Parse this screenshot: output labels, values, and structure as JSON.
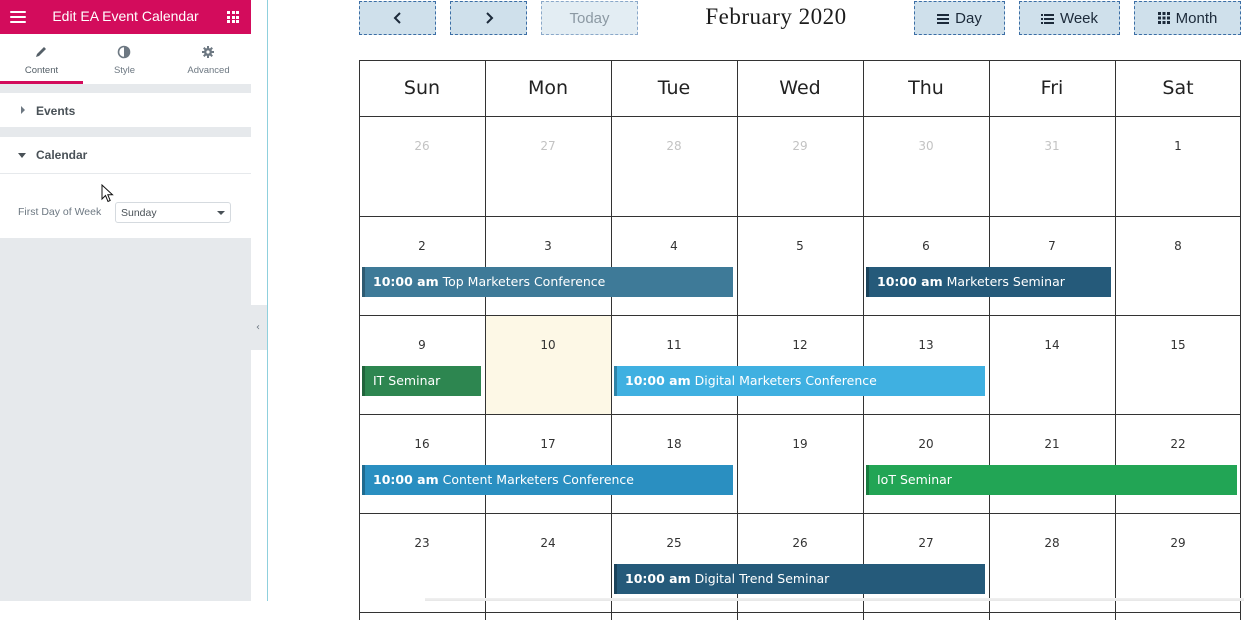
{
  "panel": {
    "title": "Edit EA Event Calendar",
    "tabs": [
      {
        "label": "Content",
        "icon": "pencil-icon",
        "active": true
      },
      {
        "label": "Style",
        "icon": "half-circle-icon",
        "active": false
      },
      {
        "label": "Advanced",
        "icon": "gear-icon",
        "active": false
      }
    ],
    "sections": {
      "events": {
        "label": "Events",
        "expanded": false
      },
      "calendar": {
        "label": "Calendar",
        "expanded": true
      }
    },
    "first_day_label": "First Day of Week",
    "first_day_value": "Sunday"
  },
  "toolbar": {
    "today_label": "Today",
    "title": "February 2020",
    "views": [
      {
        "label": "Day",
        "icon": "lines-icon"
      },
      {
        "label": "Week",
        "icon": "list-icon"
      },
      {
        "label": "Month",
        "icon": "grid-icon"
      }
    ]
  },
  "calendar": {
    "weekdays": [
      "Sun",
      "Mon",
      "Tue",
      "Wed",
      "Thu",
      "Fri",
      "Sat"
    ],
    "weeks": [
      [
        {
          "d": "26",
          "other": true
        },
        {
          "d": "27",
          "other": true
        },
        {
          "d": "28",
          "other": true
        },
        {
          "d": "29",
          "other": true
        },
        {
          "d": "30",
          "other": true
        },
        {
          "d": "31",
          "other": true
        },
        {
          "d": "1"
        }
      ],
      [
        {
          "d": "2"
        },
        {
          "d": "3"
        },
        {
          "d": "4"
        },
        {
          "d": "5"
        },
        {
          "d": "6"
        },
        {
          "d": "7"
        },
        {
          "d": "8"
        }
      ],
      [
        {
          "d": "9"
        },
        {
          "d": "10",
          "today": true
        },
        {
          "d": "11"
        },
        {
          "d": "12"
        },
        {
          "d": "13"
        },
        {
          "d": "14"
        },
        {
          "d": "15"
        }
      ],
      [
        {
          "d": "16"
        },
        {
          "d": "17"
        },
        {
          "d": "18"
        },
        {
          "d": "19"
        },
        {
          "d": "20"
        },
        {
          "d": "21"
        },
        {
          "d": "22"
        }
      ],
      [
        {
          "d": "23"
        },
        {
          "d": "24"
        },
        {
          "d": "25"
        },
        {
          "d": "26"
        },
        {
          "d": "27"
        },
        {
          "d": "28"
        },
        {
          "d": "29"
        }
      ]
    ],
    "events": [
      {
        "time": "10:00 am",
        "title": "Top Marketers Conference",
        "week": 1,
        "start": 0,
        "end": 2,
        "color": "#3e7a98"
      },
      {
        "time": "10:00 am",
        "title": "Marketers Seminar",
        "week": 1,
        "start": 4,
        "end": 5,
        "color": "#255a7a"
      },
      {
        "time": "",
        "title": "IT Seminar",
        "week": 2,
        "start": 0,
        "end": 0,
        "color": "#2d8650"
      },
      {
        "time": "10:00 am",
        "title": "Digital Marketers Conference",
        "week": 2,
        "start": 2,
        "end": 4,
        "color": "#3fb0e1"
      },
      {
        "time": "10:00 am",
        "title": "Content Marketers Conference",
        "week": 3,
        "start": 0,
        "end": 2,
        "color": "#2a8fc1"
      },
      {
        "time": "",
        "title": "IoT Seminar",
        "week": 3,
        "start": 4,
        "end": 6,
        "color": "#22a555"
      },
      {
        "time": "10:00 am",
        "title": "Digital Trend Seminar",
        "week": 4,
        "start": 2,
        "end": 4,
        "color": "#255a7a"
      }
    ]
  }
}
